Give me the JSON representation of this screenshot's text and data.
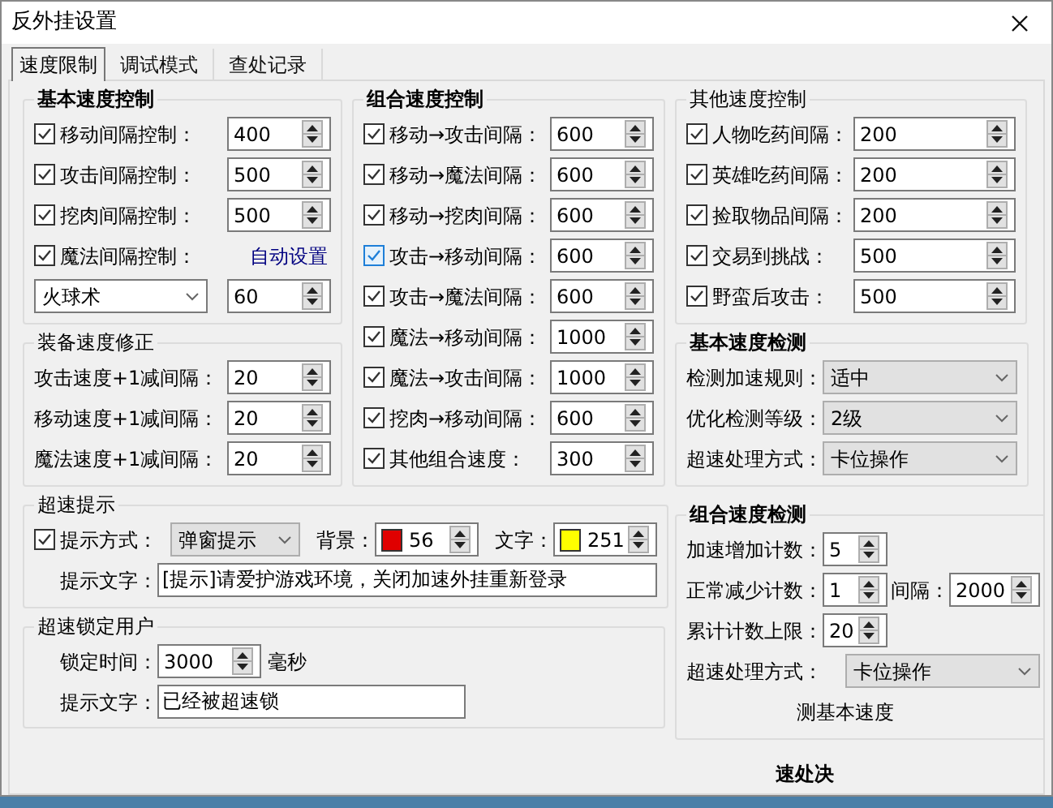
{
  "window": {
    "title": "反外挂设置"
  },
  "tabs": [
    {
      "label": "速度限制",
      "selected": true
    },
    {
      "label": "调试模式",
      "selected": false
    },
    {
      "label": "查处记录",
      "selected": false
    }
  ],
  "basic_speed_control": {
    "title": "基本速度控制",
    "bold": true,
    "rows": [
      {
        "label": "移动间隔控制：",
        "checked": true,
        "value": "400"
      },
      {
        "label": "攻击间隔控制：",
        "checked": true,
        "value": "500"
      },
      {
        "label": "挖肉间隔控制：",
        "checked": true,
        "value": "500"
      }
    ],
    "magic": {
      "label": "魔法间隔控制：",
      "checked": true,
      "link": "自动设置",
      "spell": "火球术",
      "value": "60"
    }
  },
  "equipment_correction": {
    "title": "装备速度修正",
    "bold": false,
    "rows": [
      {
        "label": "攻击速度+1减间隔：",
        "value": "20"
      },
      {
        "label": "移动速度+1减间隔：",
        "value": "20"
      },
      {
        "label": "魔法速度+1减间隔：",
        "value": "20"
      }
    ]
  },
  "combo_speed_control": {
    "title": "组合速度控制",
    "bold": true,
    "rows": [
      {
        "label": "移动→攻击间隔：",
        "checked": true,
        "hovered": false,
        "value": "600"
      },
      {
        "label": "移动→魔法间隔：",
        "checked": true,
        "hovered": false,
        "value": "600"
      },
      {
        "label": "移动→挖肉间隔：",
        "checked": true,
        "hovered": false,
        "value": "600"
      },
      {
        "label": "攻击→移动间隔：",
        "checked": true,
        "hovered": true,
        "value": "600"
      },
      {
        "label": "攻击→魔法间隔：",
        "checked": true,
        "hovered": false,
        "value": "600"
      },
      {
        "label": "魔法→移动间隔：",
        "checked": true,
        "hovered": false,
        "value": "1000"
      },
      {
        "label": "魔法→攻击间隔：",
        "checked": true,
        "hovered": false,
        "value": "1000"
      },
      {
        "label": "挖肉→移动间隔：",
        "checked": true,
        "hovered": false,
        "value": "600"
      },
      {
        "label": "其他组合速度：",
        "checked": true,
        "hovered": false,
        "value": "300"
      }
    ]
  },
  "other_speed_control": {
    "title": "其他速度控制",
    "bold": false,
    "rows": [
      {
        "label": "人物吃药间隔：",
        "checked": true,
        "value": "200"
      },
      {
        "label": "英雄吃药间隔：",
        "checked": true,
        "value": "200"
      },
      {
        "label": "捡取物品间隔：",
        "checked": true,
        "value": "200"
      },
      {
        "label": "交易到挑战：",
        "checked": true,
        "value": "500"
      },
      {
        "label": "野蛮后攻击：",
        "checked": true,
        "value": "500"
      }
    ]
  },
  "basic_speed_detection": {
    "title": "基本速度检测",
    "bold": true,
    "rows": [
      {
        "label": "检测加速规则：",
        "value": "适中"
      },
      {
        "label": "优化检测等级：",
        "value": "2级"
      },
      {
        "label": "超速处理方式：",
        "value": "卡位操作"
      }
    ]
  },
  "overspeed_alert": {
    "title": "超速提示",
    "bold": false,
    "method": {
      "label": "提示方式：",
      "checked": true,
      "value": "弹窗提示"
    },
    "background": {
      "label": "背景：",
      "color": "#e00000",
      "value": "56"
    },
    "text_color": {
      "label": "文字：",
      "color": "#ffff00",
      "value": "251"
    },
    "message": {
      "label": "提示文字：",
      "value": "[提示]请爱护游戏环境，关闭加速外挂重新登录"
    }
  },
  "overspeed_lock": {
    "title": "超速锁定用户",
    "bold": false,
    "time": {
      "label": "锁定时间：",
      "value": "3000",
      "unit": "毫秒"
    },
    "message": {
      "label": "提示文字：",
      "value": "已经被超速锁"
    }
  },
  "combo_speed_detection": {
    "title": "组合速度检测",
    "bold": true,
    "rows": [
      {
        "label": "加速增加计数：",
        "value": "5"
      },
      {
        "label": "正常减少计数：",
        "value": "1",
        "extra_label": "间隔：",
        "extra_value": "2000"
      },
      {
        "label": "累计计数上限：",
        "value": "20"
      }
    ],
    "handling": {
      "label": "超速处理方式：",
      "value": "卡位操作"
    },
    "option": {
      "label": "测基本速度"
    }
  },
  "next_group": {
    "title": "速处决",
    "bold": true
  }
}
